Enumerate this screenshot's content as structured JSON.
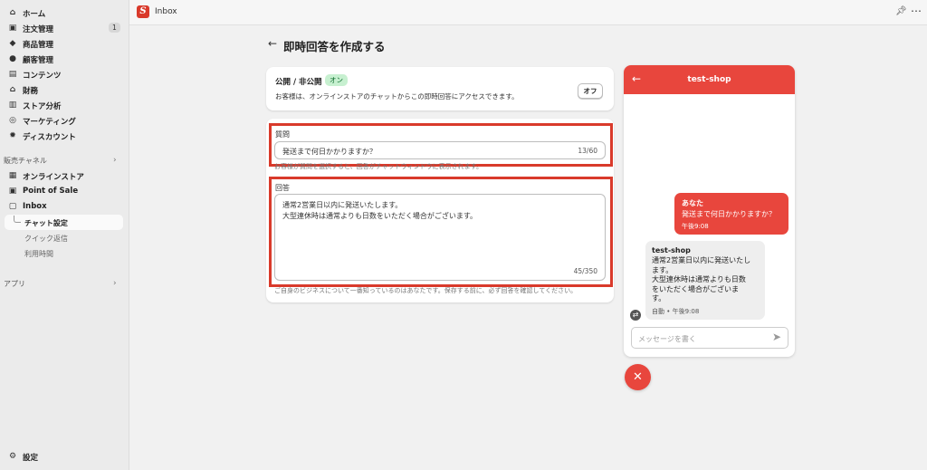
{
  "topbar": {
    "app_title": "Inbox",
    "logo_letter": "S"
  },
  "sidebar": {
    "items": [
      {
        "label": "ホーム",
        "icon": "home-icon"
      },
      {
        "label": "注文管理",
        "icon": "inbox-icon",
        "badge": "1"
      },
      {
        "label": "商品管理",
        "icon": "tag-icon"
      },
      {
        "label": "顧客管理",
        "icon": "person-icon"
      },
      {
        "label": "コンテンツ",
        "icon": "content-icon"
      },
      {
        "label": "財務",
        "icon": "bank-icon"
      },
      {
        "label": "ストア分析",
        "icon": "chart-icon"
      },
      {
        "label": "マーケティング",
        "icon": "target-icon"
      },
      {
        "label": "ディスカウント",
        "icon": "gear-discount-icon"
      }
    ],
    "sales_channels_title": "販売チャネル",
    "channels": [
      {
        "label": "オンラインストア",
        "icon": "store-icon"
      },
      {
        "label": "Point of Sale",
        "icon": "pos-icon"
      },
      {
        "label": "Inbox",
        "icon": "inbox-app-icon"
      }
    ],
    "sub_items": [
      {
        "label": "チャット設定",
        "active": true
      },
      {
        "label": "クイック返信"
      },
      {
        "label": "利用時間"
      }
    ],
    "apps_title": "アプリ",
    "settings_label": "設定"
  },
  "main": {
    "page_title": "即時回答を作成する",
    "visibility": {
      "title": "公開 / 非公開",
      "status_badge": "オン",
      "description": "お客様は、オンラインストアのチャットからこの即時回答にアクセスできます。",
      "toggle_button": "オフ"
    },
    "question": {
      "label": "質問",
      "value": "発送まで何日かかりますか？",
      "counter": "13/60",
      "help": "お客様が質問を選択すると、回答がチャットウィンドウに表示されます。"
    },
    "answer": {
      "label": "回答",
      "line1": "通常2営業日以内に発送いたします。",
      "line2": "大型連休時は通常よりも日数をいただく場合がございます。",
      "counter": "45/350",
      "help": "ご自身のビジネスについて一番知っているのはあなたです。保存する前に、必ず回答を確認してください。"
    }
  },
  "chat_preview": {
    "shop_name": "test-shop",
    "user_message": {
      "name": "あなた",
      "text": "発送まで何日かかりますか？",
      "time": "午後9:08"
    },
    "shop_message": {
      "name": "test-shop",
      "line1": "通常2営業日以内に発送いたし",
      "line2": "ます。",
      "line3": "大型連休時は通常よりも日数",
      "line4": "をいただく場合がございま",
      "line5": "す。",
      "time": "自動 • 午後9:08"
    },
    "input_placeholder": "メッセージを書く"
  },
  "colors": {
    "accent": "#e8463d",
    "highlight_border": "#d93a2b",
    "on_badge_bg": "#c7f0d0"
  }
}
